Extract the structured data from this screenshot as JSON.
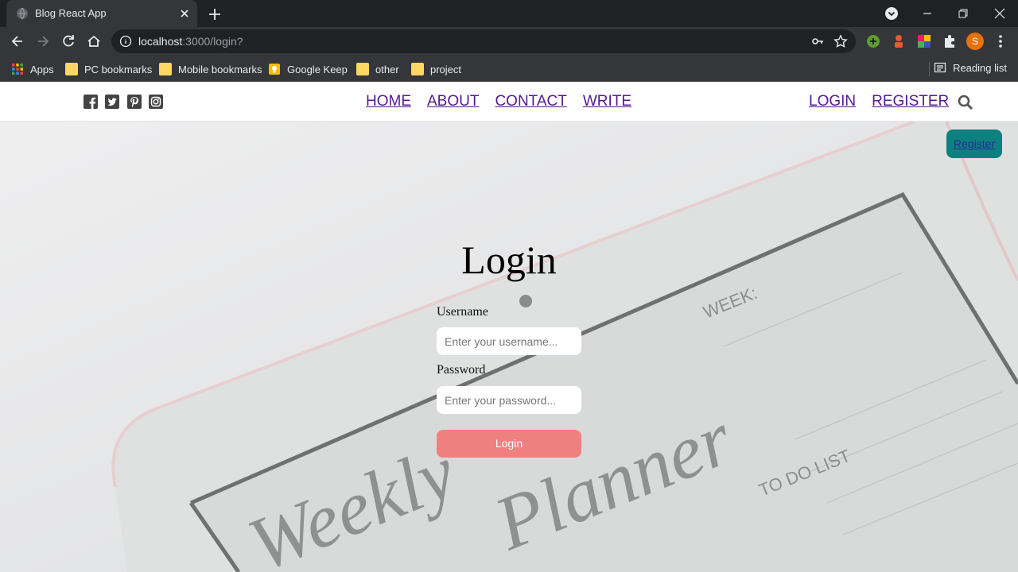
{
  "browser": {
    "tab_title": "Blog React App",
    "url_host": "localhost",
    "url_rest": ":3000/login?",
    "profile_initial": "S",
    "bookmarks": [
      {
        "label": "Apps"
      },
      {
        "label": "PC bookmarks"
      },
      {
        "label": "Mobile bookmarks"
      },
      {
        "label": "Google Keep"
      },
      {
        "label": "other"
      },
      {
        "label": "project"
      }
    ],
    "reading_list": "Reading list"
  },
  "topbar": {
    "nav": [
      "HOME",
      "ABOUT",
      "CONTACT",
      "WRITE"
    ],
    "right": [
      "LOGIN",
      "REGISTER"
    ]
  },
  "page": {
    "register_button": "Register",
    "title": "Login",
    "username_label": "Username",
    "username_placeholder": "Enter your username...",
    "password_label": "Password",
    "password_placeholder": "Enter your password...",
    "login_button": "Login"
  },
  "background_text": {
    "week": "WEEK:",
    "todo": "TO DO LIST",
    "script_1": "Weekly",
    "script_2": "Planner"
  },
  "colors": {
    "login_button": "#f08080",
    "register_button": "#0d8080",
    "link": "#551a8b"
  }
}
